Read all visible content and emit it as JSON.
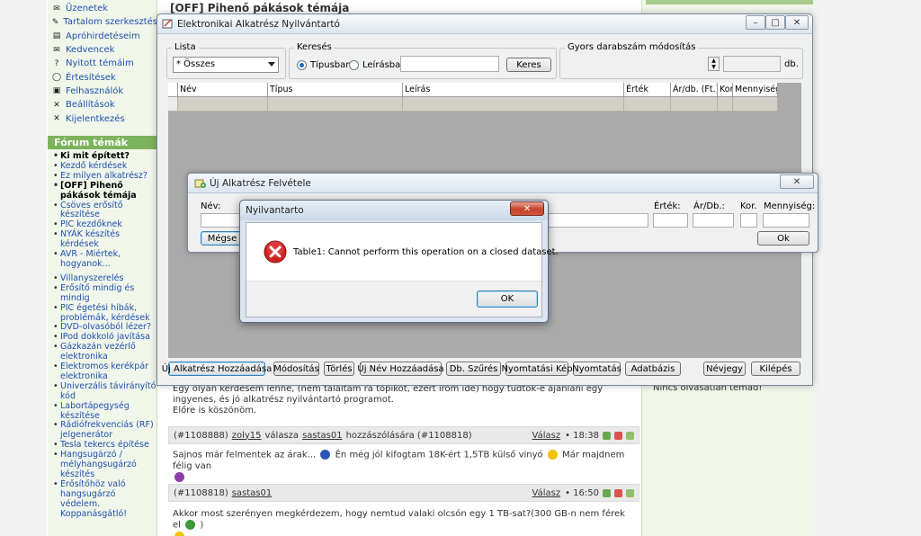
{
  "forum": {
    "thread_title": "[OFF] Pihenő pákások témája",
    "menu": [
      {
        "label": "Üzenetek",
        "icon": "✉"
      },
      {
        "label": "Tartalom szerkesztés",
        "icon": "✎"
      },
      {
        "label": "Apróhirdetéseim",
        "icon": "▤"
      },
      {
        "label": "Kedvencek",
        "icon": "✉"
      },
      {
        "label": "Nyitott témáim",
        "icon": "?"
      },
      {
        "label": "Értesítések",
        "icon": "◯"
      },
      {
        "label": "Felhasználók",
        "icon": "▣"
      },
      {
        "label": "Beállítások",
        "icon": "✕"
      },
      {
        "label": "Kijelentkezés",
        "icon": "✕"
      }
    ],
    "topics_header": "Fórum témák",
    "topics_group1": [
      {
        "label": "Ki mit épített?",
        "bold": true
      },
      {
        "label": "Kezdő kérdések",
        "bold": false
      },
      {
        "label": "Ez milyen alkatrész?",
        "bold": false
      },
      {
        "label": "[OFF] Pihenő pákások témája",
        "bold": true
      },
      {
        "label": "Csöves erősítő készítése",
        "bold": false
      },
      {
        "label": "PIC kezdőknek",
        "bold": false
      },
      {
        "label": "NYÁK készítés kérdések",
        "bold": false
      },
      {
        "label": "AVR - Miértek, hogyanok...",
        "bold": false
      }
    ],
    "topics_group2": [
      "Villanyszerelés",
      "Erősítő mindig és mindig",
      "PIC égetési hibák, problémák, kérdések",
      "DVD-olvasóból lézer?",
      "IPod dokkoló javítása",
      "Gázkazán vezérlő elektronika",
      "Elektromos kerékpár elektronika",
      "Univerzális távirányító kód",
      "Labortápegység készítése",
      "Rádiófrekvenciás (RF) jelgenerátor",
      "Tesla tekercs építése",
      "Hangsugárzó / mélyhangsugárzó készítés",
      "Erősítőhöz való hangsugárzó védelem. Koppanásgátló!"
    ],
    "right_text": "Nincs olvasatlan témád!",
    "post0_body": "Egy olyan kérdésem lenne, (nem találtam rá topikot, ezért írom ide) hogy tudtok-e ajánlani egy ingyenes, és jó alkatrész nyilvántartó programot.",
    "post0_body2": "Előre is köszönöm.",
    "posts": [
      {
        "id": "(#1108888)",
        "user": "zoly15",
        "mid": "válasza",
        "target": "sastas01",
        "suffix": "hozzászólására (#1108818)",
        "reply": "Válasz",
        "time": "• 18:38",
        "body": "Sajnos már felmentek az árak...",
        "body_b": "Én még jól kifogtam 18K-ért 1,5TB külső vinyó",
        "body_c": "Már majdnem félig van"
      },
      {
        "id": "(#1108818)",
        "user": "sastas01",
        "reply": "Válasz",
        "time": "• 16:50",
        "body": "Akkor most szerényen megkérdezem, hogy nemtud valaki olcsón egy 1 TB-sat?(300 GB-n nem férek el",
        "body_c": ")"
      }
    ]
  },
  "main_window": {
    "title": "Elektronikai Alkatrész Nyilvántartó",
    "lista_label": "Lista",
    "lista_value": "* Összes",
    "kereses_label": "Keresés",
    "radio_tipus": "Típusban",
    "radio_leiras": "Leírásban",
    "search_value": "",
    "search_button": "Keres",
    "quick_label": "Gyors darabszám módosítás",
    "db_suffix": "db.",
    "columns": [
      "Név",
      "Típus",
      "Leírás",
      "Érték",
      "Ár/db. (Ft.)",
      "Kor.",
      "Mennyiség"
    ],
    "buttons": [
      "Új Alkatrész Hozzáadása",
      "Módosítás",
      "Törlés",
      "Új Név Hozzáadása",
      "Db. Szűrés",
      "Nyomtatási Kép",
      "Nyomtatás",
      "Adatbázis"
    ],
    "nevjegy": "Névjegy",
    "kilepes": "Kilépés"
  },
  "part_dialog": {
    "title": "Új Alkatrész Felvétele",
    "nev_label": "Név:",
    "ertek_label": "Érték:",
    "ar_label": "Ár/Db.:",
    "kor_label": "Kor.",
    "menny_label": "Mennyiség:",
    "megse": "Mégse",
    "ok": "Ok"
  },
  "error_dialog": {
    "title": "Nyilvantarto",
    "message": "Table1: Cannot perform this operation on a closed dataset.",
    "ok": "OK"
  },
  "colors": {
    "accent_green": "#7db35c",
    "error_red": "#cc2222"
  }
}
